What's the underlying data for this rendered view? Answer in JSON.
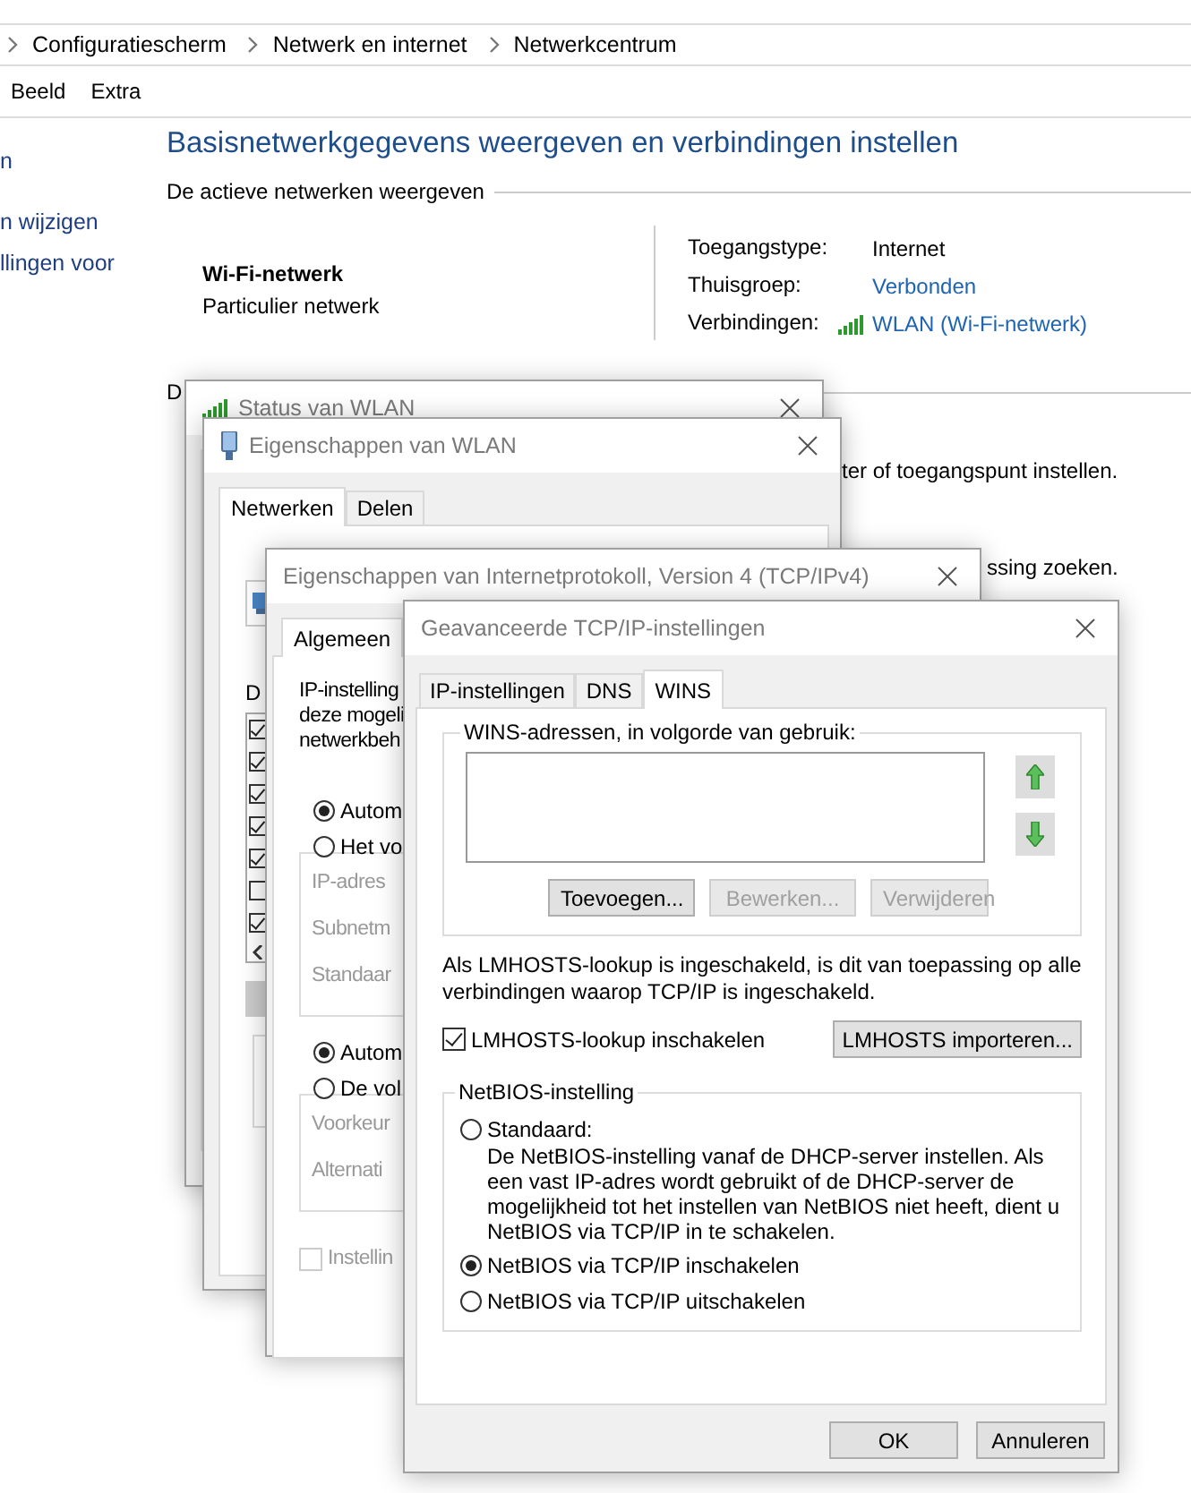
{
  "explorer": {
    "breadcrumb": [
      "Configuratiescherm",
      "Netwerk en internet",
      "Netwerkcentrum"
    ],
    "menu": [
      "Beeld",
      "Extra"
    ],
    "sidebar_links": [
      "n",
      "n wijzigen",
      "llingen voor"
    ],
    "heading": "Basisnetwerkgegevens weergeven en verbindingen instellen",
    "active_networks": {
      "title": "De actieve netwerken weergeven",
      "network_name": "Wi-Fi-netwerk",
      "network_type": "Particulier netwerk",
      "properties": [
        {
          "label": "Toegangstype:",
          "value": "Internet",
          "kind": "text"
        },
        {
          "label": "Thuisgroep:",
          "value": "Verbonden",
          "kind": "link"
        },
        {
          "label": "Verbindingen:",
          "value": "WLAN (Wi-Fi-netwerk)",
          "kind": "wifi-link"
        }
      ]
    },
    "settings_section": {
      "title": "D",
      "fragments": [
        "ter of toegangspunt instellen.",
        "ssing zoeken."
      ]
    }
  },
  "status_window": {
    "title": "Status van WLAN"
  },
  "wlan_properties": {
    "title": "Eigenschappen van WLAN",
    "tabs": [
      {
        "label": "Netwerken",
        "selected": true
      },
      {
        "label": "Delen",
        "selected": false
      }
    ],
    "items_label": "D",
    "items": [
      {
        "checked": true
      },
      {
        "checked": true
      },
      {
        "checked": true
      },
      {
        "checked": true
      },
      {
        "checked": true
      },
      {
        "checked": false
      },
      {
        "checked": true
      }
    ]
  },
  "ipv4_properties": {
    "title": "Eigenschappen van Internetprotokoll, Version 4 (TCP/IPv4)",
    "tabs": [
      {
        "label": "Algemeen",
        "selected": true
      }
    ],
    "intro": [
      "IP-instelling",
      "deze mogeli",
      "netwerkbeh"
    ],
    "ip_options": [
      {
        "label": "Autom",
        "selected": true
      },
      {
        "label": "Het vo",
        "selected": false
      }
    ],
    "ip_fields": [
      "IP-adres",
      "Subnetm",
      "Standaar"
    ],
    "dns_options": [
      {
        "label": "Autom",
        "selected": true
      },
      {
        "label": "De vol",
        "selected": false
      }
    ],
    "dns_fields": [
      "Voorkeur",
      "Alternati"
    ],
    "validate": {
      "label": "Instellin",
      "checked": false,
      "disabled": true
    }
  },
  "advanced": {
    "title": "Geavanceerde TCP/IP-instellingen",
    "tabs": [
      {
        "label": "IP-instellingen",
        "selected": false
      },
      {
        "label": "DNS",
        "selected": false
      },
      {
        "label": "WINS",
        "selected": true
      }
    ],
    "wins_group": {
      "title": "WINS-adressen, in volgorde van gebruik:",
      "buttons": [
        {
          "label": "Toevoegen...",
          "disabled": false
        },
        {
          "label": "Bewerken...",
          "disabled": true
        },
        {
          "label": "Verwijderen",
          "disabled": true
        }
      ]
    },
    "lmhosts_note": "Als LMHOSTS-lookup is ingeschakeld, is dit van toepassing op alle verbindingen waarop TCP/IP is ingeschakeld.",
    "lmhosts_lookup": {
      "label": "LMHOSTS-lookup inschakelen",
      "checked": true
    },
    "import_button": "LMHOSTS importeren...",
    "netbios": {
      "title": "NetBIOS-instelling",
      "options": [
        {
          "label": "Standaard:",
          "description": "De NetBIOS-instelling vanaf de DHCP-server instellen. Als een vast IP-adres wordt gebruikt of de DHCP-server de mogelijkheid tot het instellen van NetBIOS niet heeft, dient u NetBIOS via TCP/IP in te schakelen.",
          "selected": false
        },
        {
          "label": "NetBIOS via TCP/IP inschakelen",
          "selected": true
        },
        {
          "label": "NetBIOS via TCP/IP uitschakelen",
          "selected": false
        }
      ]
    },
    "buttons": [
      "OK",
      "Annuleren"
    ]
  }
}
